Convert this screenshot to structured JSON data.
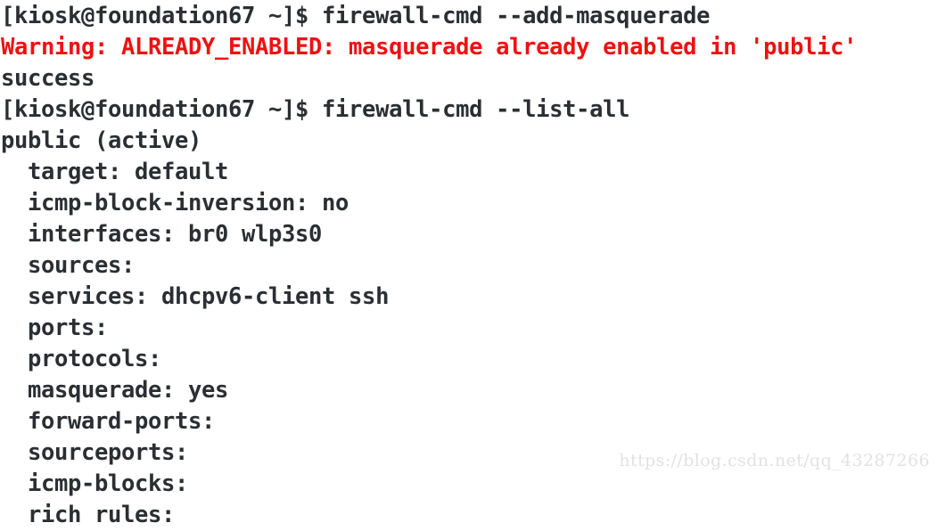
{
  "terminal": {
    "prompt": "[kiosk@foundation67 ~]$",
    "foreground_color": "#2b2f33",
    "background_color": "#ffffff",
    "warning_color": "#ee1111",
    "lines": [
      {
        "id": "cmd-add-masquerade",
        "text": "[kiosk@foundation67 ~]$ firewall-cmd --add-masquerade",
        "style": "normal"
      },
      {
        "id": "warning-already-enabled",
        "text": "Warning: ALREADY_ENABLED: masquerade already enabled in 'public'",
        "style": "warning"
      },
      {
        "id": "result-success",
        "text": "success",
        "style": "normal"
      },
      {
        "id": "cmd-list-all",
        "text": "[kiosk@foundation67 ~]$ firewall-cmd --list-all",
        "style": "normal"
      },
      {
        "id": "zone-public-active",
        "text": "public (active)",
        "style": "normal"
      },
      {
        "id": "field-target",
        "text": "  target: default",
        "style": "normal"
      },
      {
        "id": "field-icmp-block-inversion",
        "text": "  icmp-block-inversion: no",
        "style": "normal"
      },
      {
        "id": "field-interfaces",
        "text": "  interfaces: br0 wlp3s0",
        "style": "normal"
      },
      {
        "id": "field-sources",
        "text": "  sources:",
        "style": "normal"
      },
      {
        "id": "field-services",
        "text": "  services: dhcpv6-client ssh",
        "style": "normal"
      },
      {
        "id": "field-ports",
        "text": "  ports:",
        "style": "normal"
      },
      {
        "id": "field-protocols",
        "text": "  protocols:",
        "style": "normal"
      },
      {
        "id": "field-masquerade",
        "text": "  masquerade: yes",
        "style": "normal"
      },
      {
        "id": "field-forward-ports",
        "text": "  forward-ports:",
        "style": "normal"
      },
      {
        "id": "field-sourceports",
        "text": "  sourceports:",
        "style": "normal"
      },
      {
        "id": "field-icmp-blocks",
        "text": "  icmp-blocks:",
        "style": "normal"
      },
      {
        "id": "field-rich-rules",
        "text": "  rich rules:",
        "style": "normal"
      }
    ]
  },
  "watermark": {
    "text": "https://blog.csdn.net/qq_43287266",
    "color": "#e2e2e2"
  }
}
